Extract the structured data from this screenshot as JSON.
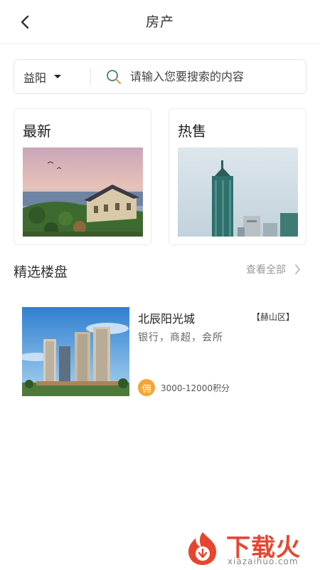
{
  "header": {
    "title": "房产",
    "back_icon": "chevron-left-icon"
  },
  "search": {
    "city": "益阳",
    "placeholder": "请输入您要搜索的内容",
    "value": "",
    "icon": "search-icon"
  },
  "categories": [
    {
      "title": "最新",
      "image": "villa-sunset-photo"
    },
    {
      "title": "热售",
      "image": "highrise-tower-photo"
    }
  ],
  "featured": {
    "title": "精选楼盘",
    "view_all": "查看全部",
    "items": [
      {
        "name": "北辰阳光城",
        "district": "【赫山区】",
        "tags": "银行，商超，会所",
        "commission_badge": "佣",
        "commission": "3000-12000积分",
        "image": "apartment-towers-photo"
      }
    ]
  },
  "watermark": {
    "brand": "下载火",
    "domain": "xiazaihuo.com"
  },
  "colors": {
    "accent_orange": "#f4a533",
    "watermark_red": "#e8452f",
    "search_icon": "#3f7f7a"
  }
}
